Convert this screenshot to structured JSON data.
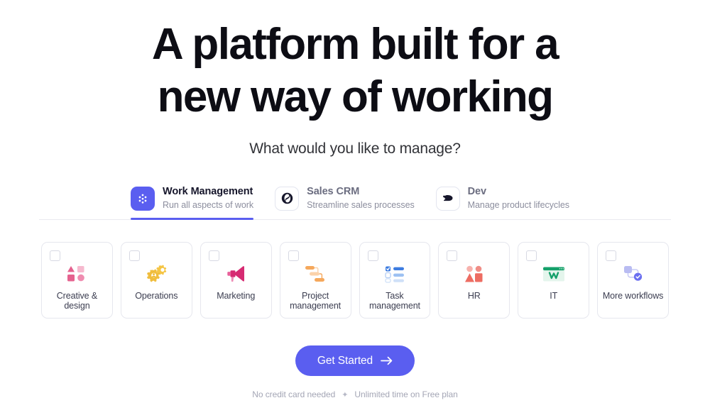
{
  "hero": {
    "title_line1": "A platform built for a",
    "title_line2": "new way of working",
    "subtitle": "What would you like to manage?"
  },
  "tabs": [
    {
      "id": "work-management",
      "name": "Work Management",
      "desc": "Run all aspects of work",
      "icon": "dots-grid-icon",
      "active": true,
      "icon_bg": "#5a5ef0"
    },
    {
      "id": "sales-crm",
      "name": "Sales CRM",
      "desc": "Streamline sales processes",
      "icon": "crm-swirl-icon",
      "active": false,
      "icon_bg": "#ffffff"
    },
    {
      "id": "dev",
      "name": "Dev",
      "desc": "Manage product lifecycles",
      "icon": "dev-comet-icon",
      "active": false,
      "icon_bg": "#ffffff"
    }
  ],
  "cards": [
    {
      "id": "creative-design",
      "label": "Creative & design",
      "icon": "shapes-icon",
      "color": "#e5628f"
    },
    {
      "id": "operations",
      "label": "Operations",
      "icon": "gears-icon",
      "color": "#f5c544"
    },
    {
      "id": "marketing",
      "label": "Marketing",
      "icon": "megaphone-icon",
      "color": "#d62b72"
    },
    {
      "id": "project-management",
      "label": "Project management",
      "icon": "gantt-icon",
      "color": "#f5a85c"
    },
    {
      "id": "task-management",
      "label": "Task management",
      "icon": "checklist-icon",
      "color": "#3d7ce0"
    },
    {
      "id": "hr",
      "label": "HR",
      "icon": "people-icon",
      "color": "#ed6c62"
    },
    {
      "id": "it",
      "label": "IT",
      "icon": "browser-w-icon",
      "color": "#14a06a"
    },
    {
      "id": "more-workflows",
      "label": "More workflows",
      "icon": "workflow-icon",
      "color": "#6b6ff0"
    }
  ],
  "cta": {
    "label": "Get Started",
    "arrow_icon": "arrow-right-icon",
    "note_left": "No credit card needed",
    "note_separator": "✦",
    "note_right": "Unlimited time on Free plan"
  },
  "theme": {
    "accent": "#5a5ef0",
    "text_dark": "#0d0d14",
    "text_muted": "#8c8e9e",
    "border": "#e6e7ee"
  }
}
